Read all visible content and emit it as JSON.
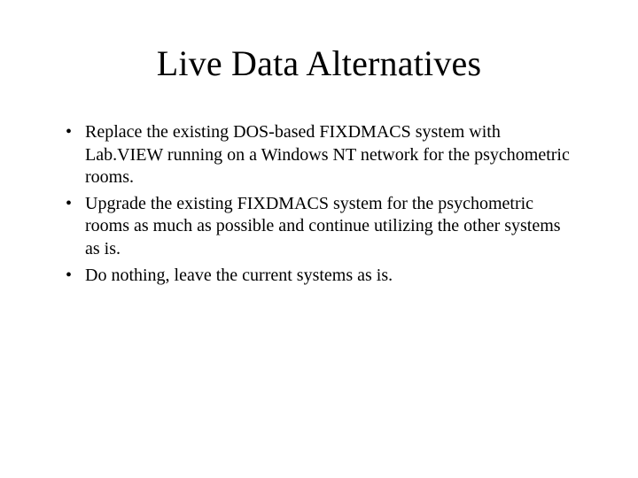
{
  "title": "Live Data Alternatives",
  "bullets": [
    "Replace the existing DOS-based FIXDMACS system with Lab.VIEW running on a Windows NT network for the psychometric rooms.",
    "Upgrade the existing FIXDMACS system for the psychometric rooms as much as possible and continue utilizing the other systems as is.",
    "Do nothing, leave the current systems as is."
  ]
}
